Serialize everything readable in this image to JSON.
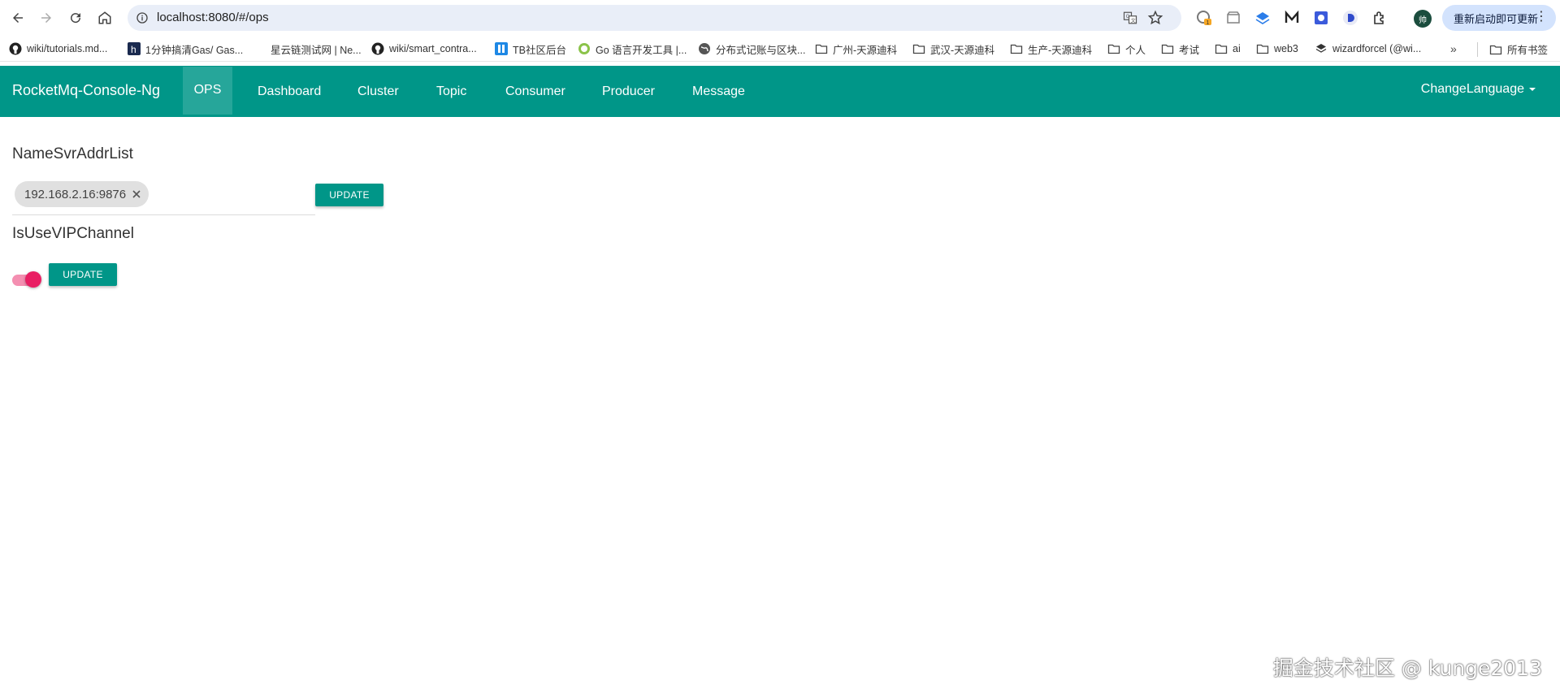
{
  "browser": {
    "url": "localhost:8080/#/ops",
    "update_label": "重新启动即可更新",
    "profile_initial": "帅",
    "extension_badge": "1",
    "bookmarks": [
      {
        "label": "wiki/tutorials.md...",
        "icon": "github-icon"
      },
      {
        "label": "1分钟搞清Gas/ Gas...",
        "icon": "h-site-icon"
      },
      {
        "label": "星云链测试网 | Ne...",
        "icon": "blank-icon"
      },
      {
        "label": "wiki/smart_contra...",
        "icon": "github-icon"
      },
      {
        "label": "TB社区后台",
        "icon": "tb-icon"
      },
      {
        "label": "Go 语言开发工具 |...",
        "icon": "go-icon"
      },
      {
        "label": "分布式记账与区块...",
        "icon": "globe-icon"
      },
      {
        "label": "广州-天源迪科",
        "icon": "folder-icon"
      },
      {
        "label": "武汉-天源迪科",
        "icon": "folder-icon"
      },
      {
        "label": "生产-天源迪科",
        "icon": "folder-icon"
      },
      {
        "label": "个人",
        "icon": "folder-icon"
      },
      {
        "label": "考试",
        "icon": "folder-icon"
      },
      {
        "label": "ai",
        "icon": "folder-icon"
      },
      {
        "label": "web3",
        "icon": "folder-icon"
      },
      {
        "label": "wizardforcel (@wi...",
        "icon": "layers-icon"
      }
    ],
    "more_bookmarks": "»",
    "all_bookmarks": "所有书签"
  },
  "nav": {
    "brand": "RocketMq-Console-Ng",
    "items": [
      {
        "label": "OPS",
        "active": true
      },
      {
        "label": "Dashboard"
      },
      {
        "label": "Cluster"
      },
      {
        "label": "Topic"
      },
      {
        "label": "Consumer"
      },
      {
        "label": "Producer"
      },
      {
        "label": "Message"
      }
    ],
    "language": "ChangeLanguage"
  },
  "ops": {
    "namesrv_title": "NameSvrAddrList",
    "namesrv_chips": [
      "192.168.2.16:9876"
    ],
    "namesrv_update": "UPDATE",
    "vip_title": "IsUseVIPChannel",
    "vip_enabled": true,
    "vip_update": "UPDATE"
  },
  "watermark": "掘金技术社区 @ kunge2013",
  "colors": {
    "primary": "#009688",
    "active_tab": "#26a69a",
    "toggle_thumb": "#e91e63",
    "toggle_track": "#f48fb1"
  }
}
